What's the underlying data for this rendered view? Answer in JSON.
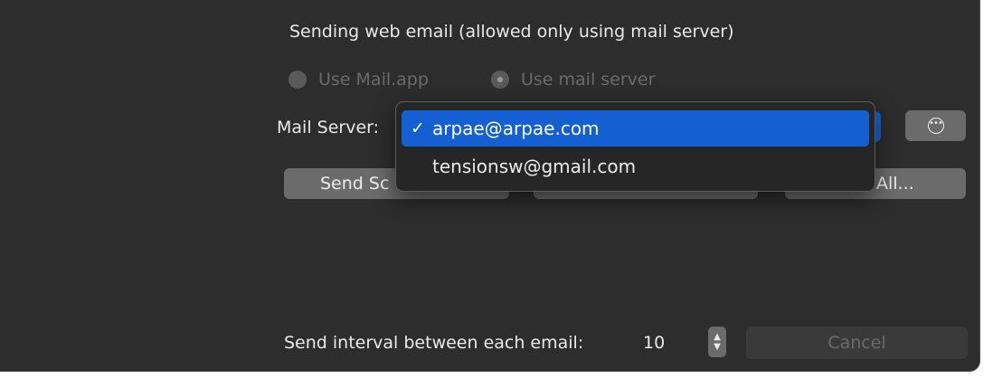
{
  "section": {
    "title": "Sending web email (allowed only using mail server)"
  },
  "send_method": {
    "options": [
      {
        "label": "Use Mail.app",
        "selected": false,
        "enabled": false
      },
      {
        "label": "Use mail server",
        "selected": true,
        "enabled": false
      }
    ]
  },
  "mail_server": {
    "label": "Mail Server:",
    "menu": {
      "items": [
        {
          "label": "arpae@arpae.com",
          "checked": true,
          "check_mark": "✓"
        },
        {
          "label": "tensionsw@gmail.com",
          "checked": false,
          "check_mark": ""
        }
      ]
    },
    "more_button_icon": "ellipsis-circle-icon"
  },
  "buttons": {
    "send_test_label": "Send Sc",
    "middle_label": "",
    "right_label": "All..."
  },
  "interval": {
    "label": "Send interval between each email:",
    "value": "10",
    "stepper_icon": "up-down-arrows-icon"
  },
  "cancel_label": "Cancel",
  "colors": {
    "window_bg": "#2d2d2d",
    "accent": "#1460d2",
    "button_bg": "#6b6b6b",
    "disabled_text": "#6a6a6a"
  }
}
